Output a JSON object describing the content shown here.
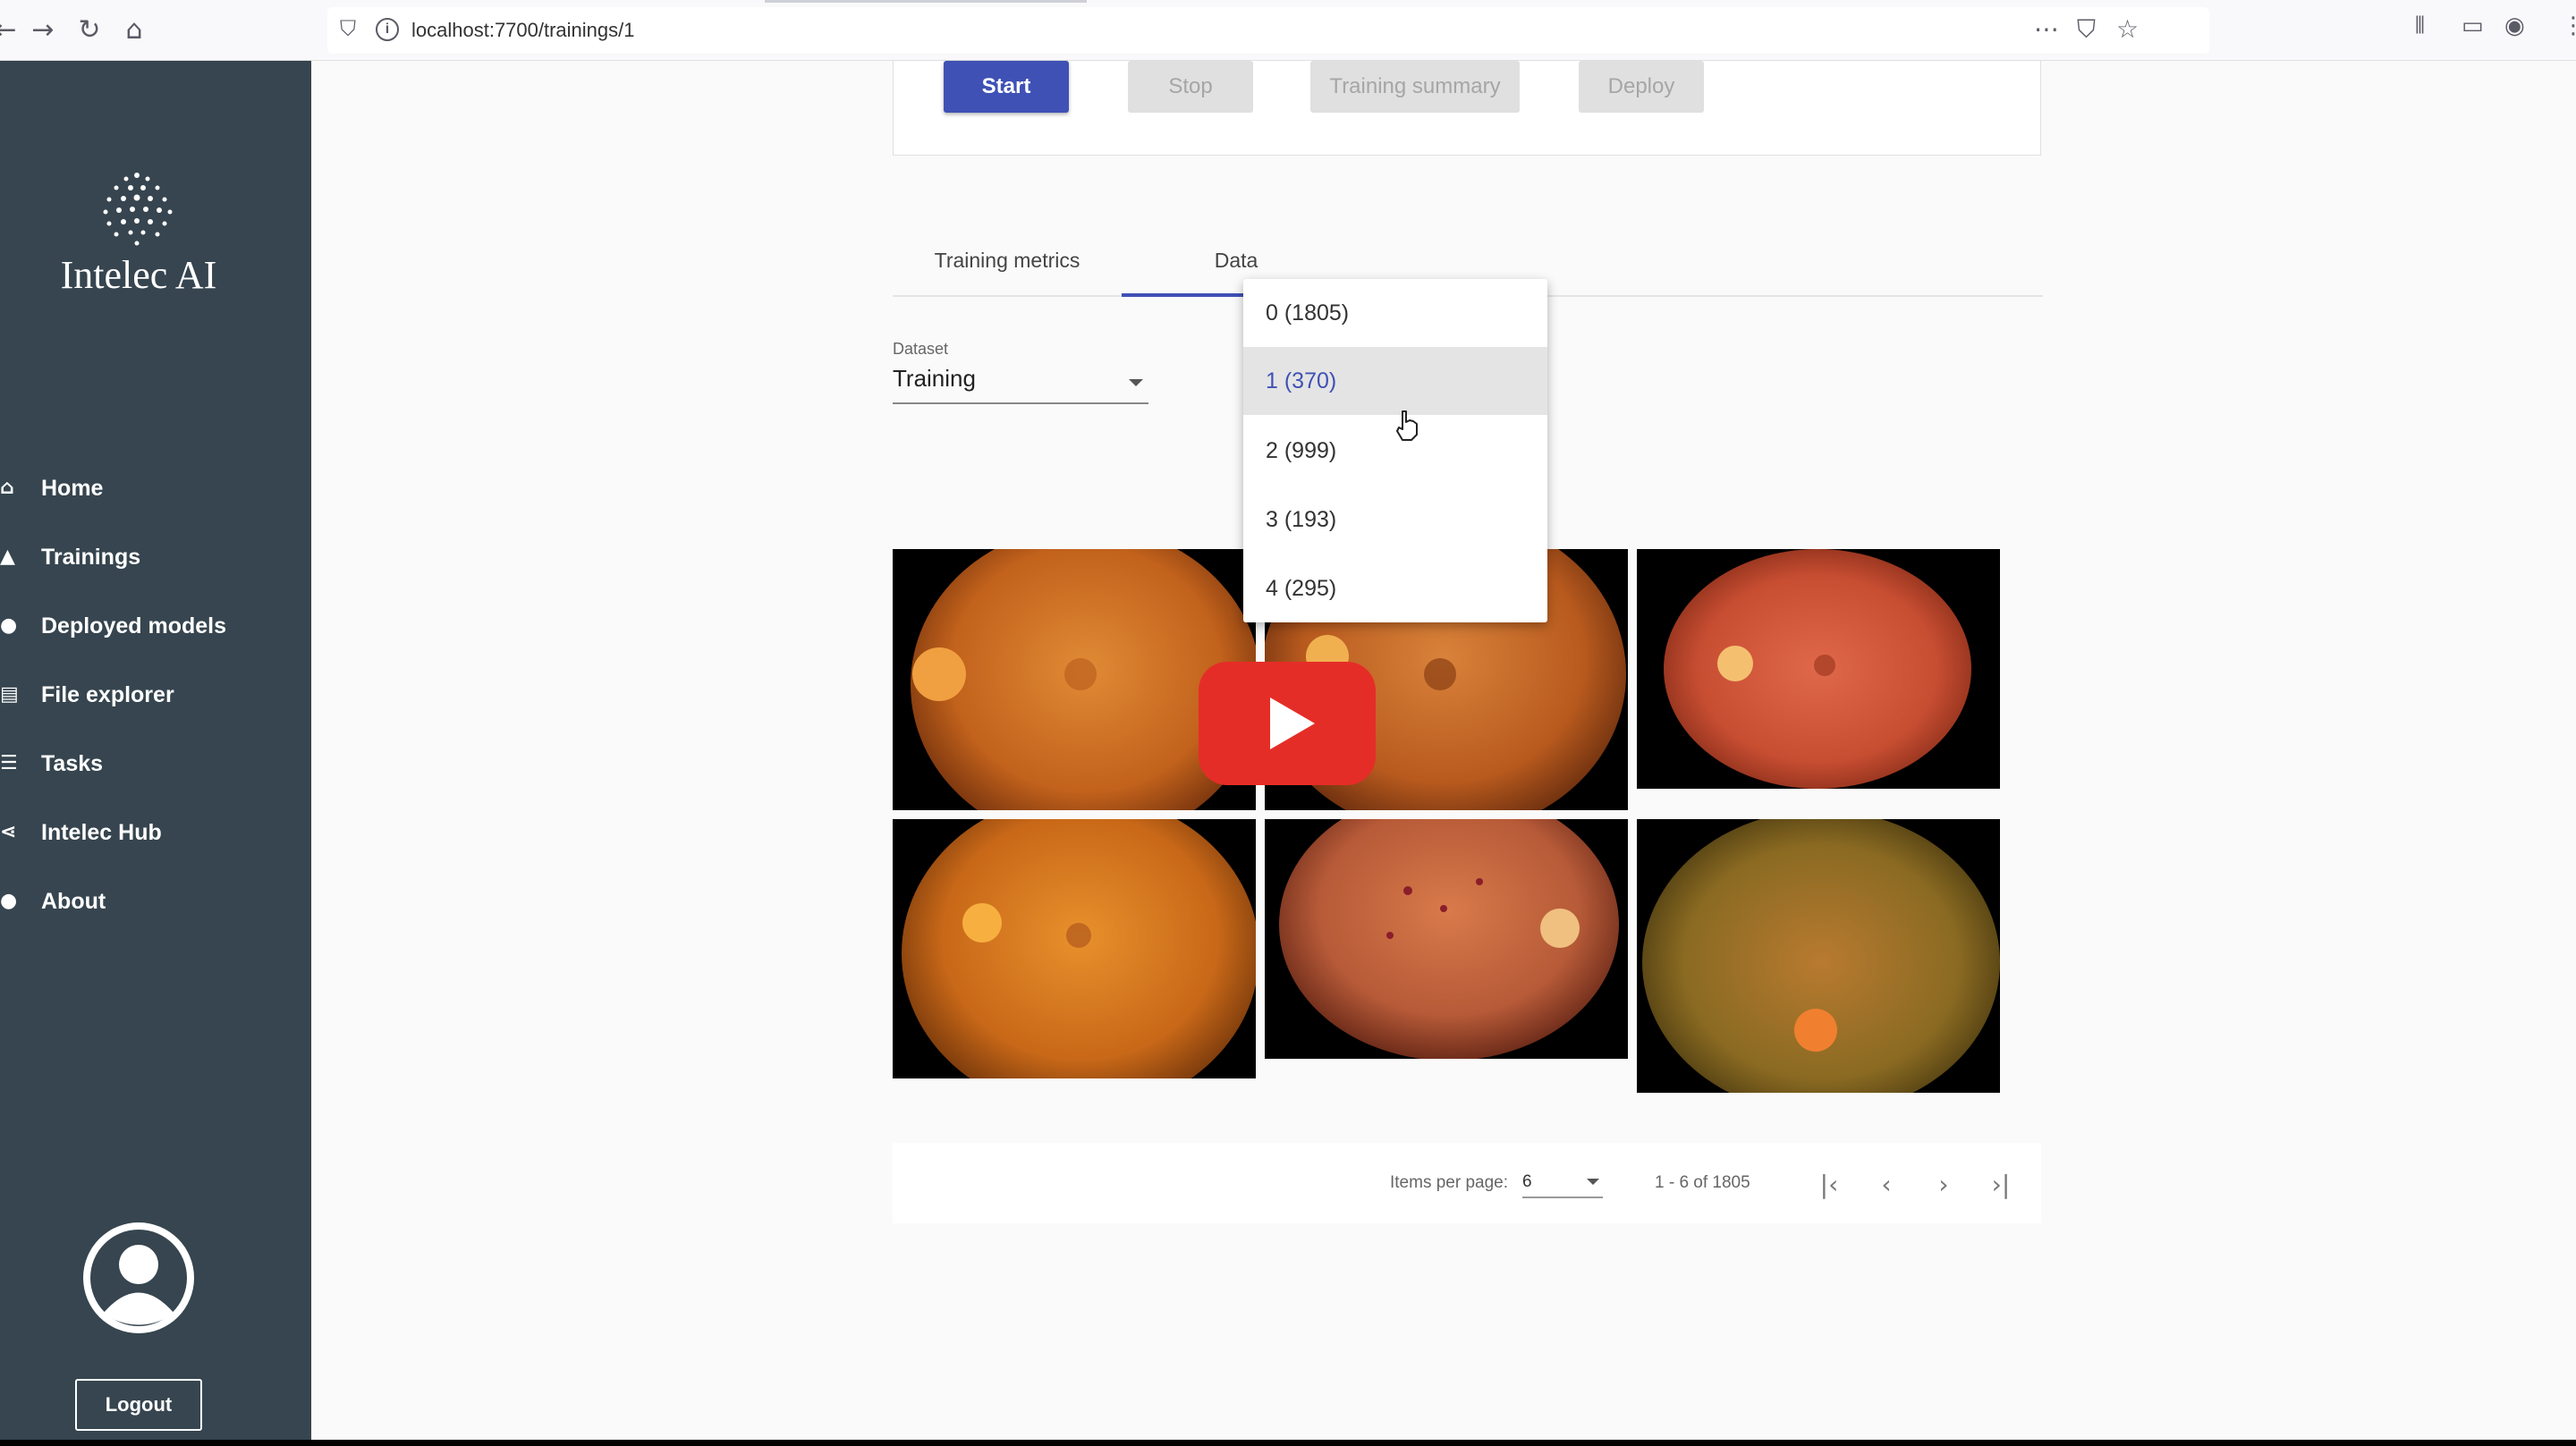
{
  "browser": {
    "url": "localhost:7700/trainings/1",
    "back_icon": "arrow-left-icon",
    "forward_icon": "arrow-right-icon",
    "reload_icon": "reload-icon",
    "home_icon": "home-icon"
  },
  "sidebar": {
    "brand": "Intelec AI",
    "items": [
      {
        "label": "Home",
        "icon": "home-icon"
      },
      {
        "label": "Trainings",
        "icon": "graduation-cap-icon"
      },
      {
        "label": "Deployed models",
        "icon": "cloud-icon"
      },
      {
        "label": "File explorer",
        "icon": "folder-icon"
      },
      {
        "label": "Tasks",
        "icon": "list-icon"
      },
      {
        "label": "Intelec Hub",
        "icon": "share-icon"
      },
      {
        "label": "About",
        "icon": "info-icon"
      }
    ],
    "logout_label": "Logout",
    "bg_color": "#36454f"
  },
  "actions": {
    "start": "Start",
    "stop": "Stop",
    "summary": "Training summary",
    "deploy": "Deploy",
    "accent_color": "#3f51b5"
  },
  "tabs": [
    {
      "label": "Training metrics",
      "active": false
    },
    {
      "label": "Data",
      "active": true
    }
  ],
  "dataset": {
    "label": "Dataset",
    "value": "Training"
  },
  "class_dropdown": {
    "options": [
      "0 (1805)",
      "1 (370)",
      "2 (999)",
      "3 (193)",
      "4 (295)"
    ],
    "highlighted": "1 (370)"
  },
  "paginator": {
    "items_per_page_label": "Items per page:",
    "items_per_page_value": "6",
    "range": "1 - 6 of 1805"
  },
  "video_overlay": {
    "icon": "youtube-play-icon",
    "color": "#e52d27"
  }
}
